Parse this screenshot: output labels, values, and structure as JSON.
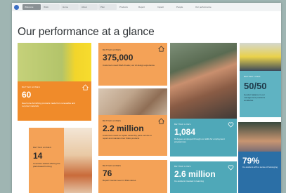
{
  "browser": {
    "tabs": [
      {
        "label": "Welcome",
        "active": true
      },
      {
        "label": "IKEA",
        "active": false
      },
      {
        "label": "Home",
        "active": false
      },
      {
        "label": "About",
        "active": false
      },
      {
        "label": "Plan",
        "active": false
      },
      {
        "label": "Products",
        "active": false
      },
      {
        "label": "Report",
        "active": false
      },
      {
        "label": "Impact",
        "active": false
      },
      {
        "label": "People",
        "active": false
      },
      {
        "label": "Our performance",
        "active": false
      }
    ]
  },
  "page": {
    "title": "Our performance at a glance"
  },
  "cards": {
    "c60": {
      "label": "BETTER HOMES",
      "value": "60",
      "desc": "Ikea home furnishing products made from renewable and recycled materials"
    },
    "c375": {
      "label": "BETTER HOMES",
      "value": "375,000",
      "desc": "Customers used IKEA Kreativ, our AI design experience"
    },
    "c22": {
      "label": "BETTER HOMES",
      "value": "2.2 million",
      "desc": "Customers used our spare assembly parts service to repair and maintain their IKEA products"
    },
    "c1084": {
      "label": "BETTER LIVES",
      "value": "1,084",
      "desc": "Refugees employed through our skills for employment programmes"
    },
    "c5050": {
      "label": "BETTER LIVES",
      "value": "50/50",
      "desc": "Gender balance in our management positions worldwide"
    },
    "c14": {
      "label": "BETTER HOMES",
      "value": "14",
      "desc": "Countries started offering the plant-based hot dog"
    },
    "c76": {
      "label": "BETTER HOMES",
      "value": "76",
      "desc": "Repair Counter seen in IKEA stores"
    },
    "c26": {
      "label": "BETTER LIVES",
      "value": "2.6 million",
      "desc": "Co-workers invested in learning"
    },
    "c79": {
      "label": "BETTER LIVES",
      "value": "79%",
      "desc": "Co-workers with a sense of belonging"
    }
  },
  "colors": {
    "orange": "#f4a257",
    "orange_dark": "#f08b2a",
    "teal": "#4fa8b8",
    "blue": "#2b6fa6",
    "frame": "#9fb5b2"
  },
  "icons": [
    "home-icon",
    "heart-icon"
  ]
}
